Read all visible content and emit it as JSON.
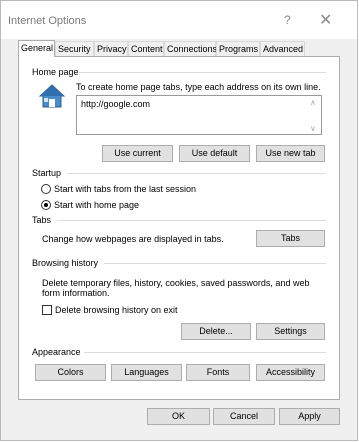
{
  "window": {
    "title": "Internet Options",
    "help_glyph": "?",
    "close_glyph": "✕"
  },
  "tabs": [
    {
      "label": "General"
    },
    {
      "label": "Security"
    },
    {
      "label": "Privacy"
    },
    {
      "label": "Content"
    },
    {
      "label": "Connections"
    },
    {
      "label": "Programs"
    },
    {
      "label": "Advanced"
    }
  ],
  "home_page": {
    "group_label": "Home page",
    "description": "To create home page tabs, type each address on its own line.",
    "address": "http://google.com",
    "use_current": "Use current",
    "use_default": "Use default",
    "use_new_tab": "Use new tab",
    "icon": "house-icon"
  },
  "startup": {
    "group_label": "Startup",
    "option1": "Start with tabs from the last session",
    "option2": "Start with home page",
    "selected": "option2"
  },
  "tabs_group": {
    "group_label": "Tabs",
    "description": "Change how webpages are displayed in tabs.",
    "button": "Tabs"
  },
  "browsing_history": {
    "group_label": "Browsing history",
    "description_line1": "Delete temporary files, history, cookies, saved passwords, and web",
    "description_line2": "form information.",
    "checkbox_label": "Delete browsing history on exit",
    "checked": false,
    "delete_button": "Delete...",
    "settings_button": "Settings"
  },
  "appearance": {
    "group_label": "Appearance",
    "colors": "Colors",
    "languages": "Languages",
    "fonts": "Fonts",
    "accessibility": "Accessibility"
  },
  "dialog_buttons": {
    "ok": "OK",
    "cancel": "Cancel",
    "apply": "Apply"
  },
  "colors": {
    "window_bg": "#f0f0f0",
    "panel_bg": "#ffffff",
    "button_bg": "#e1e1e1",
    "border": "#adadad"
  }
}
